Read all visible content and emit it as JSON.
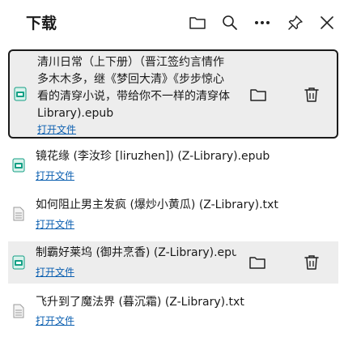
{
  "header": {
    "title": "下载",
    "icons": [
      "folder-icon",
      "search-icon",
      "more-icon",
      "pin-icon",
      "close-icon"
    ]
  },
  "downloads": [
    {
      "name_lines": [
        "清川日常（上下册）（晋江签约言情作",
        "多木木多，继《梦回大清》《步步惊心",
        "看的清穿小说，带给你不一样的清穿体",
        "Library).epub"
      ],
      "open_label": "打开文件",
      "type": "epub",
      "state": "selected"
    },
    {
      "name": "镜花缘 (李汝珍 [liruzhen]) (Z-Library).epub",
      "open_label": "打开文件",
      "type": "epub",
      "state": "normal"
    },
    {
      "name": "如何阻止男主发疯 (爆炒小黄瓜) (Z-Library).txt",
      "open_label": "打开文件",
      "type": "txt",
      "state": "normal"
    },
    {
      "name": "制霸好莱坞 (御井烹香) (Z-Library).epub",
      "open_label": "打开文件",
      "type": "epub",
      "state": "hover"
    },
    {
      "name": "飞升到了魔法界 (暮沉霜) (Z-Library).txt",
      "open_label": "打开文件",
      "type": "txt",
      "state": "normal"
    }
  ],
  "colors": {
    "link": "#0b5fb0",
    "epub_icon": "#14a085",
    "selected_bg": "#ededed"
  }
}
